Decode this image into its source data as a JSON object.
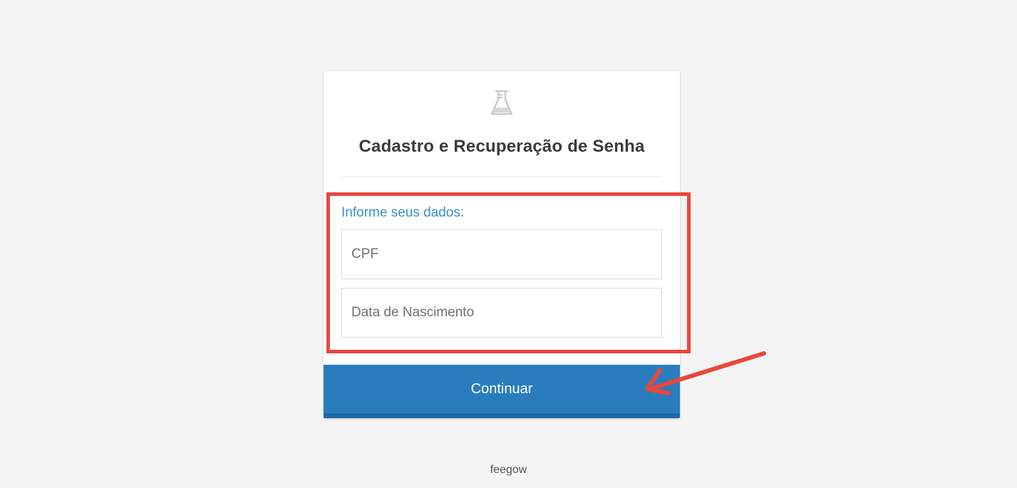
{
  "card": {
    "title": "Cadastro e Recuperação de Senha",
    "logo_icon": "flask-icon"
  },
  "form": {
    "section_label": "Informe seus dados:",
    "cpf_placeholder": "CPF",
    "dob_placeholder": "Data de Nascimento",
    "submit_label": "Continuar"
  },
  "annotations": {
    "highlight_color": "#e8473e",
    "arrow_color": "#e8473e"
  },
  "footer": {
    "brand": "feegow"
  },
  "colors": {
    "accent": "#2a7dbd",
    "label": "#3b8fc4",
    "background": "#f4f4f4"
  }
}
